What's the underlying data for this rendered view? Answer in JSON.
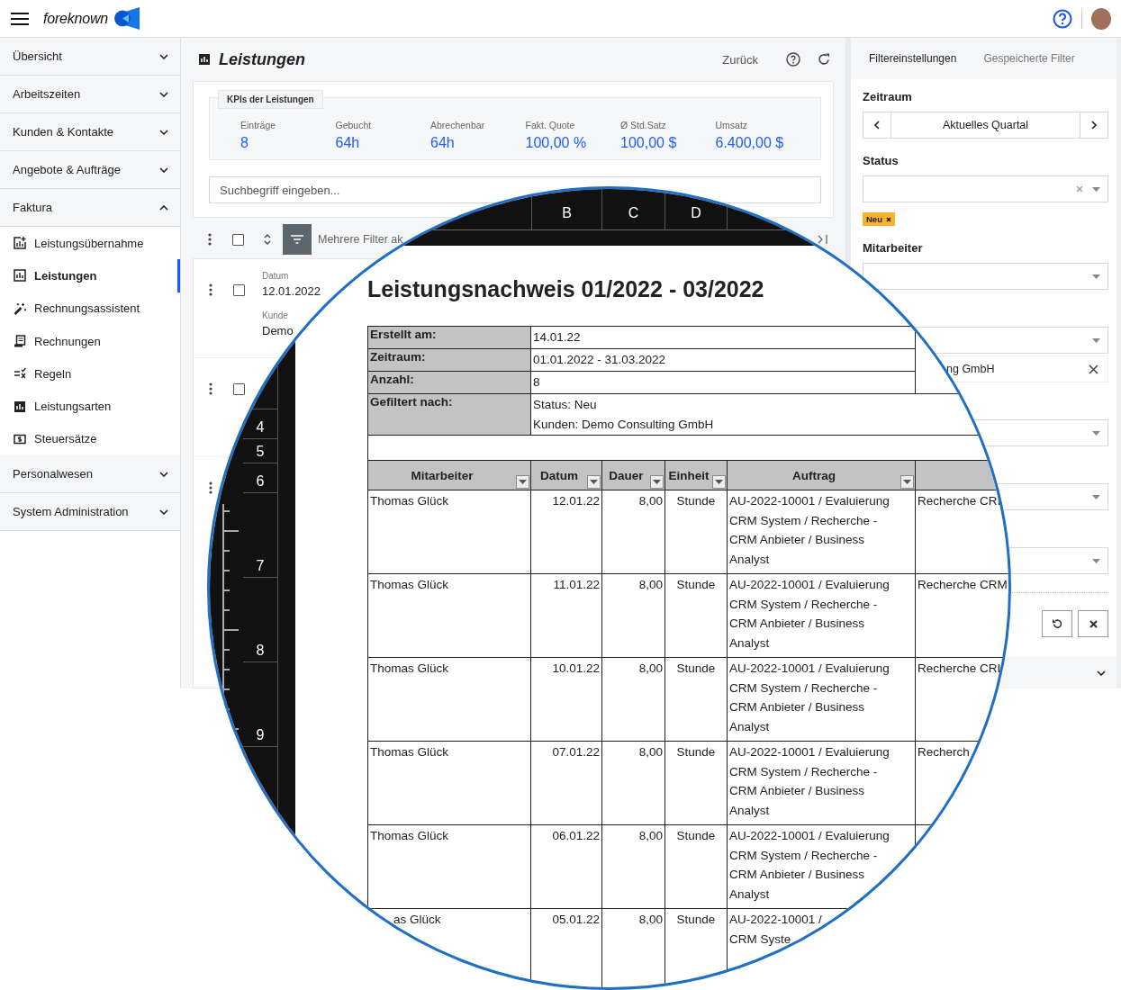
{
  "header": {
    "logo_text": "foreknown"
  },
  "sidebar": {
    "groups": [
      {
        "label": "Übersicht",
        "expanded": false
      },
      {
        "label": "Arbeitszeiten",
        "expanded": false
      },
      {
        "label": "Kunden & Kontakte",
        "expanded": false
      },
      {
        "label": "Angebote & Aufträge",
        "expanded": false
      },
      {
        "label": "Faktura",
        "expanded": true,
        "children": [
          {
            "label": "Leistungsübernahme",
            "selected": false
          },
          {
            "label": "Leistungen",
            "selected": true
          },
          {
            "label": "Rechnungsassistent",
            "selected": false
          },
          {
            "label": "Rechnungen",
            "selected": false
          },
          {
            "label": "Regeln",
            "selected": false
          },
          {
            "label": "Leistungsarten",
            "selected": false
          },
          {
            "label": "Steuersätze",
            "selected": false
          }
        ]
      },
      {
        "label": "Personalwesen",
        "expanded": false
      },
      {
        "label": "System Administration",
        "expanded": false
      }
    ]
  },
  "page": {
    "title": "Leistungen",
    "back": "Zurück"
  },
  "kpi": {
    "legend": "KPIs der Leistungen",
    "items": [
      {
        "label": "Einträge",
        "value": "8"
      },
      {
        "label": "Gebucht",
        "value": "64h"
      },
      {
        "label": "Abrechenbar",
        "value": "64h"
      },
      {
        "label": "Fakt. Quote",
        "value": "100,00 %"
      },
      {
        "label": "Ø Std.Satz",
        "value": "100,00 $"
      },
      {
        "label": "Umsatz",
        "value": "6.400,00 $"
      }
    ]
  },
  "search": {
    "placeholder": "Suchbegriff eingeben..."
  },
  "toolbar": {
    "filter_text": "Mehrere Filter ak",
    "select_all": false
  },
  "list": {
    "rows": [
      {
        "kind": "entry",
        "checked": false,
        "fields": [
          {
            "label": "Datum",
            "value": "12.01.2022"
          },
          {
            "label": "Kunde",
            "value": "Demo"
          }
        ]
      },
      {
        "kind": "entry",
        "checked": false
      },
      {
        "kind": "menu"
      }
    ]
  },
  "filter_panel": {
    "tabs": [
      {
        "label": "Filtereinstellungen",
        "selected": true
      },
      {
        "label": "Gespeicherte Filter",
        "selected": false
      }
    ],
    "filters": [
      {
        "kind": "stepper",
        "label": "Zeitraum",
        "value": "Aktuelles Quartal"
      },
      {
        "kind": "select",
        "label": "Status",
        "clearable": true,
        "tags": [
          {
            "label": "Neu"
          }
        ]
      },
      {
        "kind": "select",
        "label": "Mitarbeiter"
      },
      {
        "kind": "select"
      },
      {
        "kind": "value",
        "value": "ng GmbH"
      },
      {
        "kind": "select"
      },
      {
        "kind": "select"
      },
      {
        "kind": "select"
      }
    ]
  },
  "spreadsheet": {
    "column_letters": [
      "B",
      "C",
      "D"
    ],
    "row_numbers": [
      "4",
      "5",
      "6",
      "7",
      "8",
      "9"
    ],
    "title": "Leistungsnachweis 01/2022 - 03/2022",
    "info": [
      {
        "label": "Erstellt am:",
        "lines": [
          "14.01.22"
        ]
      },
      {
        "label": "Zeitraum:",
        "lines": [
          "01.01.2022 - 31.03.2022"
        ]
      },
      {
        "label": "Anzahl:",
        "lines": [
          "8"
        ]
      },
      {
        "label": "Gefiltert nach:",
        "lines": [
          "Status: Neu",
          "Kunden: Demo Consulting GmbH"
        ]
      }
    ],
    "columns": [
      "Mitarbeiter",
      "Datum",
      "Dauer",
      "Einheit",
      "Auftrag"
    ],
    "rows": [
      {
        "cells": [
          [
            "Thomas Glück"
          ],
          [
            "12.01.22"
          ],
          [
            "8,00"
          ],
          [
            "Stunde"
          ],
          [
            "AU-2022-10001 / Evaluierung",
            "CRM System / Recherche -",
            "CRM Anbieter / Business",
            "Analyst"
          ],
          [
            "Recherche CRI"
          ]
        ]
      },
      {
        "cells": [
          [
            "Thomas Glück"
          ],
          [
            "11.01.22"
          ],
          [
            "8,00"
          ],
          [
            "Stunde"
          ],
          [
            "AU-2022-10001 / Evaluierung",
            "CRM System / Recherche -",
            "CRM Anbieter / Business",
            "Analyst"
          ],
          [
            "Recherche CRM"
          ]
        ]
      },
      {
        "cells": [
          [
            "Thomas Glück"
          ],
          [
            "10.01.22"
          ],
          [
            "8,00"
          ],
          [
            "Stunde"
          ],
          [
            "AU-2022-10001 / Evaluierung",
            "CRM System / Recherche -",
            "CRM Anbieter / Business",
            "Analyst"
          ],
          [
            "Recherche CRI"
          ]
        ]
      },
      {
        "cells": [
          [
            "Thomas Glück"
          ],
          [
            "07.01.22"
          ],
          [
            "8,00"
          ],
          [
            "Stunde"
          ],
          [
            "AU-2022-10001 / Evaluierung",
            "CRM System / Recherche -",
            "CRM Anbieter / Business",
            "Analyst"
          ],
          [
            "Recherch"
          ]
        ]
      },
      {
        "cells": [
          [
            "Thomas Glück"
          ],
          [
            "06.01.22"
          ],
          [
            "8,00"
          ],
          [
            "Stunde"
          ],
          [
            "AU-2022-10001 / Evaluierung",
            "CRM System / Recherche -",
            "CRM Anbieter / Business",
            "Analyst"
          ],
          []
        ]
      },
      {
        "cells": [
          [
            "as Glück"
          ],
          [
            "05.01.22"
          ],
          [
            "8,00"
          ],
          [
            "Stunde"
          ],
          [
            "AU-2022-10001 /",
            "CRM Syste"
          ],
          []
        ]
      }
    ]
  }
}
